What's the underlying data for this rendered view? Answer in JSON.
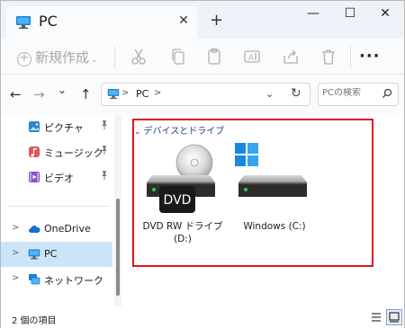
{
  "window": {
    "tab_title": "PC",
    "new_tab_label": "+",
    "close_tab_glyph": "✕",
    "minimize_glyph": "—",
    "maximize_glyph": "☐",
    "close_glyph": "✕"
  },
  "commandbar": {
    "new_label": "新規作成",
    "more_glyph": "···",
    "tools": [
      "cut-icon",
      "copy-icon",
      "paste-icon",
      "rename-icon",
      "share-icon",
      "delete-icon"
    ]
  },
  "navigation": {
    "back_glyph": "←",
    "forward_glyph": "→",
    "recent_glyph": "⌄",
    "up_glyph": "↑",
    "breadcrumb": [
      "PC"
    ],
    "breadcrumb_sep": ">",
    "dropdown_glyph": "⌄",
    "refresh_glyph": "↻",
    "search_placeholder": "PCの検索"
  },
  "sidebar": {
    "quick_access": [
      {
        "label": "ピクチャ",
        "icon": "pictures-icon",
        "pinned": true
      },
      {
        "label": "ミュージック",
        "icon": "music-icon",
        "pinned": true
      },
      {
        "label": "ビデオ",
        "icon": "videos-icon",
        "pinned": true
      }
    ],
    "locations": [
      {
        "label": "OneDrive",
        "icon": "onedrive-icon",
        "selected": false
      },
      {
        "label": "PC",
        "icon": "pc-icon",
        "selected": true
      },
      {
        "label": "ネットワーク",
        "icon": "network-icon",
        "selected": false
      }
    ],
    "expand_glyph": ">",
    "pin_glyph": "📌"
  },
  "main": {
    "group_header": "デバイスとドライブ",
    "group_chevron": "⌄",
    "drives": [
      {
        "label": "DVD RW ドライブ (D:)",
        "badge": "DVD",
        "icon": "dvd-drive-icon"
      },
      {
        "label": "Windows (C:)",
        "icon": "windows-drive-icon"
      }
    ]
  },
  "status": {
    "item_count": "2 個の項目"
  },
  "colors": {
    "highlight_border": "#e0141b",
    "selection": "#cce4f7",
    "titlebar": "#eef3f9",
    "accent": "#0078d4"
  }
}
